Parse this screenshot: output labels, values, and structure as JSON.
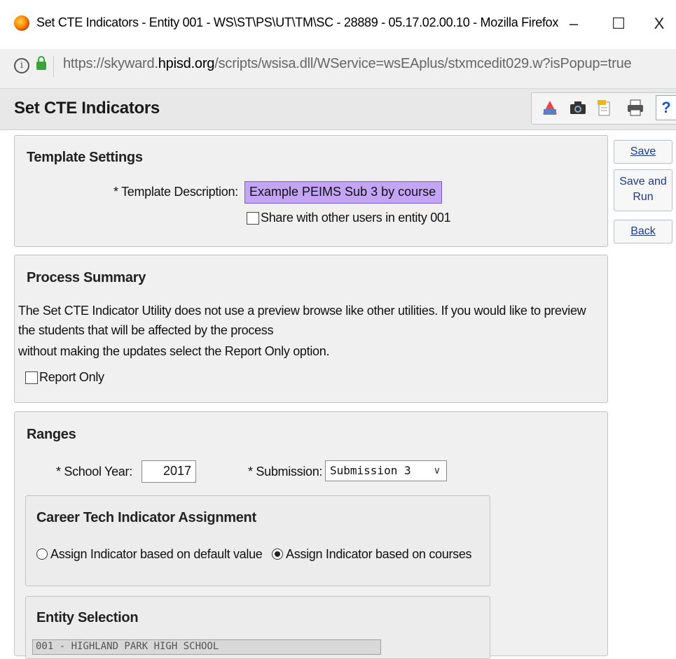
{
  "window": {
    "title": "Set CTE Indicators - Entity 001 - WS\\ST\\PS\\UT\\TM\\SC - 28889 - 05.17.02.00.10 - Mozilla Firefox",
    "minimize": "–",
    "maximize": "☐",
    "close": "X"
  },
  "address": {
    "url_prefix": "https://skyward.",
    "url_domain": "hpisd.org",
    "url_suffix": "/scripts/wsisa.dll/WService=wsEAplus/stxmcedit029.w?isPopup=true"
  },
  "app": {
    "title": "Set CTE Indicators",
    "help": "?"
  },
  "side_buttons": {
    "save": "Save",
    "save_and_run_line1": "Save and",
    "save_and_run_line2": "Run",
    "back": "Back"
  },
  "template_settings": {
    "title": "Template Settings",
    "description_label": "* Template Description:",
    "description_value": "Example PEIMS Sub 3 by course",
    "share_label": "Share with other users in entity 001"
  },
  "process_summary": {
    "title": "Process Summary",
    "line1": "The Set CTE Indicator Utility does not use a preview browse like other utilities. If you would like to preview",
    "line2": "the students that will be affected by the process",
    "line3": "without making the updates select the Report Only option.",
    "report_only_label": "Report Only"
  },
  "ranges": {
    "title": "Ranges",
    "school_year_label": "* School Year:",
    "school_year_value": "2017",
    "submission_label": "* Submission:",
    "submission_value": "Submission 3"
  },
  "career_tech": {
    "title": "Career Tech Indicator Assignment",
    "option_default": "Assign Indicator based on default value",
    "option_courses": "Assign Indicator based on courses"
  },
  "entity_selection": {
    "title": "Entity Selection",
    "first_item": "001 - HIGHLAND PARK HIGH SCHOOL"
  }
}
